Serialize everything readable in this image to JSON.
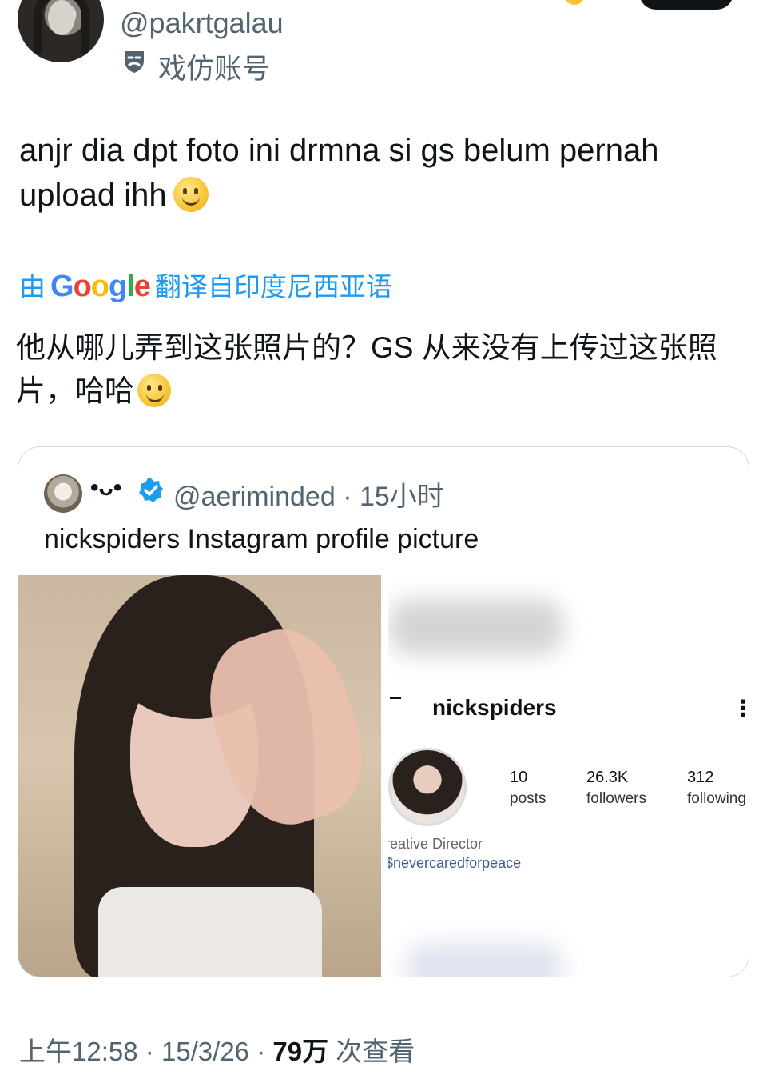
{
  "author": {
    "handle": "@pakrtgalau",
    "account_label": "戏仿账号",
    "label_icon": "parody-mask-icon"
  },
  "tweet": {
    "text_line1": "anjr dia dpt foto ini drmna si gs belum pernah",
    "text_line2": "upload ihh",
    "emoji": "slightly-smiling-face"
  },
  "translation": {
    "prefix": "由",
    "provider": "Google",
    "suffix": "翻译自印度尼西亚语",
    "text_line1": "他从哪儿弄到这张照片的？GS 从来没有上传过这张照",
    "text_line2": "片，哈哈"
  },
  "quote": {
    "name": "•ᴗ•",
    "handle": "@aeriminded",
    "separator": "·",
    "time": "15小时",
    "text": "nickspiders Instagram profile picture",
    "instagram": {
      "username": "nickspiders",
      "more": "⋮",
      "posts_value": "10",
      "posts_label": "posts",
      "followers_value": "26.3K",
      "followers_label": "followers",
      "following_value": "312",
      "following_label": "following",
      "bio_line1": "reative Director",
      "bio_line2": "$nevercaredforpeace"
    }
  },
  "footer": {
    "time": "上午12:58",
    "sep1": "·",
    "date": "15/3/26",
    "sep2": "·",
    "views_value": "79万",
    "views_label": "次查看"
  },
  "colors": {
    "link_blue": "#1d9bf0",
    "secondary_text": "#536471",
    "primary_text": "#0f1419",
    "verified_blue": "#1d9bf0"
  }
}
